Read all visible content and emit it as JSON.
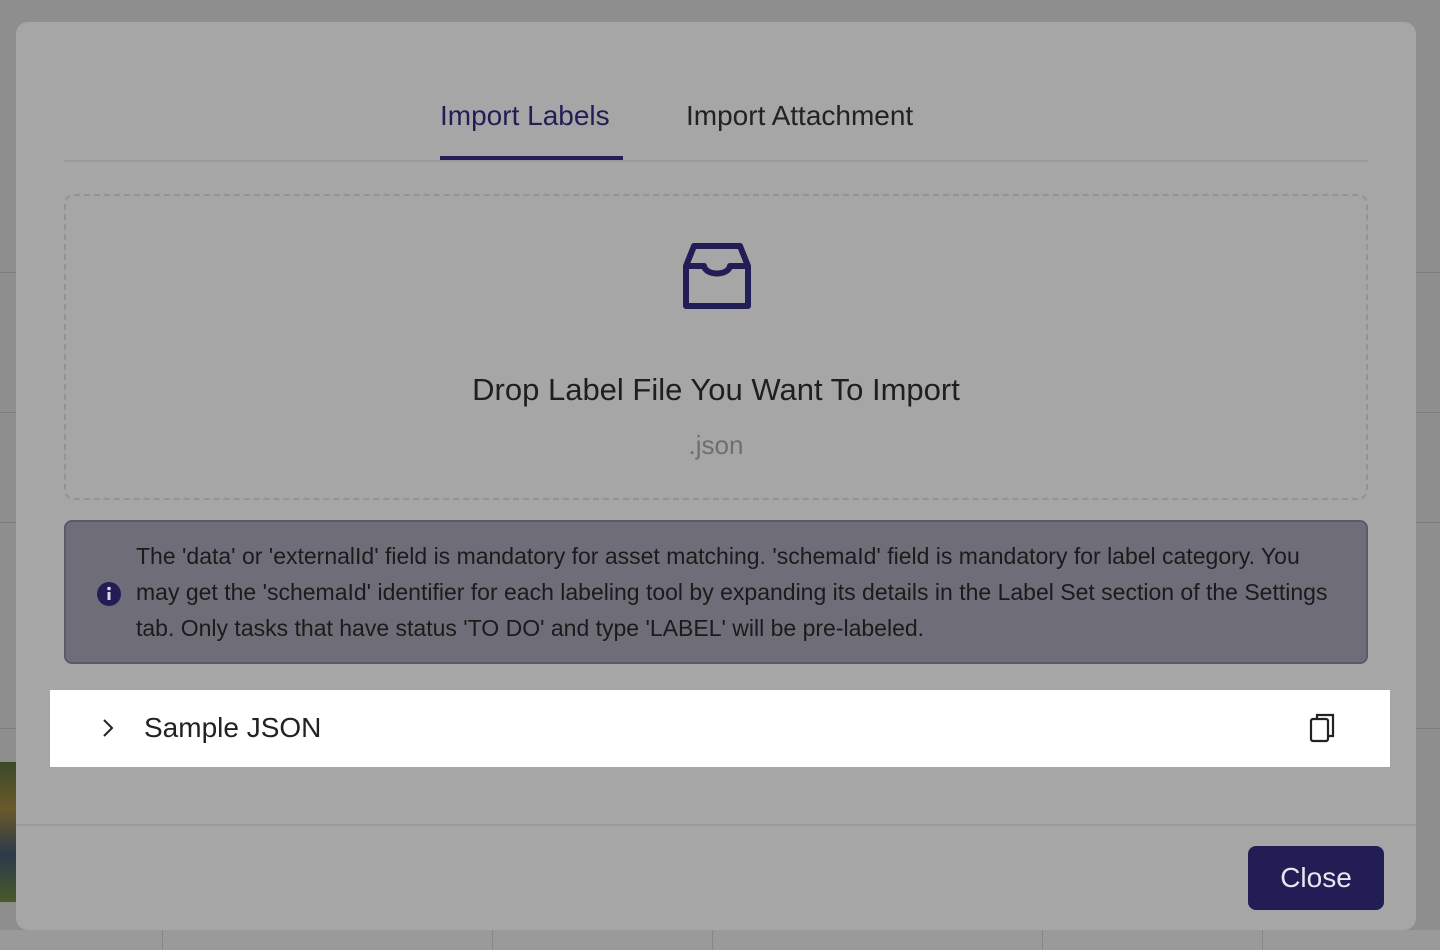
{
  "tabs": [
    {
      "label": "Import Labels",
      "active": true
    },
    {
      "label": "Import Attachment",
      "active": false
    }
  ],
  "dropzone": {
    "icon": "inbox-icon",
    "title": "Drop Label File You Want To Import",
    "hint": ".json"
  },
  "alert": {
    "icon": "info-icon",
    "text": "The 'data' or 'externalId' field is mandatory for asset matching. 'schemaId' field is mandatory for label category. You may get the 'schemaId' identifier for each labeling tool by expanding its details in the Label Set section of the Settings tab. Only tasks that have status 'TO DO' and type 'LABEL' will be pre-labeled."
  },
  "sample": {
    "title": "Sample JSON",
    "expand_icon": "chevron-right-icon",
    "copy_icon": "copy-icon",
    "expanded": false
  },
  "footer": {
    "close_label": "Close"
  },
  "colors": {
    "accent": "#221e55",
    "overlay": "#a6a6a6",
    "alert_bg": "#6f6e78"
  }
}
